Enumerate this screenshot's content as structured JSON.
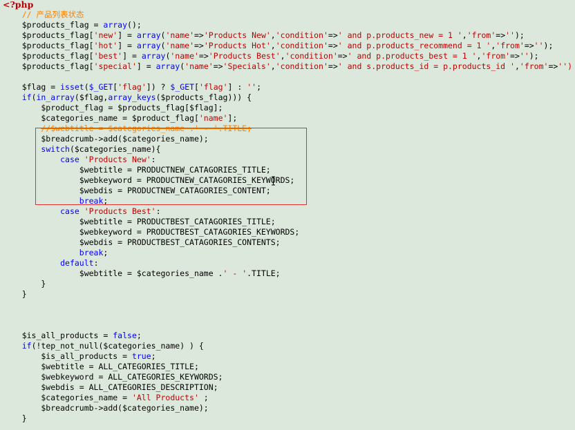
{
  "highlight_color": "#e03030",
  "background_color": "#dce8dc",
  "code_lines": [
    [
      {
        "t": "<?php",
        "c": "tag"
      }
    ],
    [
      {
        "t": "    "
      },
      {
        "t": "// 产品列表状态",
        "c": "cm"
      }
    ],
    [
      {
        "t": "    $products_flag = "
      },
      {
        "t": "array",
        "c": "kw"
      },
      {
        "t": "();"
      }
    ],
    [
      {
        "t": "    $products_flag["
      },
      {
        "t": "'new'",
        "c": "str"
      },
      {
        "t": "] = "
      },
      {
        "t": "array",
        "c": "kw"
      },
      {
        "t": "("
      },
      {
        "t": "'name'",
        "c": "str"
      },
      {
        "t": "=>"
      },
      {
        "t": "'Products New'",
        "c": "str"
      },
      {
        "t": ","
      },
      {
        "t": "'condition'",
        "c": "str"
      },
      {
        "t": "=>"
      },
      {
        "t": "' and p.products_new = 1 '",
        "c": "str"
      },
      {
        "t": ","
      },
      {
        "t": "'from'",
        "c": "str"
      },
      {
        "t": "=>"
      },
      {
        "t": "''",
        "c": "str"
      },
      {
        "t": ");"
      }
    ],
    [
      {
        "t": "    $products_flag["
      },
      {
        "t": "'hot'",
        "c": "str"
      },
      {
        "t": "] = "
      },
      {
        "t": "array",
        "c": "kw"
      },
      {
        "t": "("
      },
      {
        "t": "'name'",
        "c": "str"
      },
      {
        "t": "=>"
      },
      {
        "t": "'Products Hot'",
        "c": "str"
      },
      {
        "t": ","
      },
      {
        "t": "'condition'",
        "c": "str"
      },
      {
        "t": "=>"
      },
      {
        "t": "' and p.products_recommend = 1 '",
        "c": "str"
      },
      {
        "t": ","
      },
      {
        "t": "'from'",
        "c": "str"
      },
      {
        "t": "=>"
      },
      {
        "t": "''",
        "c": "str"
      },
      {
        "t": ");"
      }
    ],
    [
      {
        "t": "    $products_flag["
      },
      {
        "t": "'best'",
        "c": "str"
      },
      {
        "t": "] = "
      },
      {
        "t": "array",
        "c": "kw"
      },
      {
        "t": "("
      },
      {
        "t": "'name'",
        "c": "str"
      },
      {
        "t": "=>"
      },
      {
        "t": "'Products Best'",
        "c": "str"
      },
      {
        "t": ","
      },
      {
        "t": "'condition'",
        "c": "str"
      },
      {
        "t": "=>"
      },
      {
        "t": "' and p.products_best = 1 '",
        "c": "str"
      },
      {
        "t": ","
      },
      {
        "t": "'from'",
        "c": "str"
      },
      {
        "t": "=>"
      },
      {
        "t": "''",
        "c": "str"
      },
      {
        "t": ");"
      }
    ],
    [
      {
        "t": "    $products_flag["
      },
      {
        "t": "'special'",
        "c": "str"
      },
      {
        "t": "] = "
      },
      {
        "t": "array",
        "c": "kw"
      },
      {
        "t": "("
      },
      {
        "t": "'name'",
        "c": "str"
      },
      {
        "t": "=>"
      },
      {
        "t": "'Specials'",
        "c": "str"
      },
      {
        "t": ","
      },
      {
        "t": "'condition'",
        "c": "str"
      },
      {
        "t": "=>"
      },
      {
        "t": "' and s.products_id = p.products_id '",
        "c": "str"
      },
      {
        "t": ","
      },
      {
        "t": "'from'",
        "c": "str"
      },
      {
        "t": "=>"
      },
      {
        "t": "'')",
        "c": "str"
      }
    ],
    [
      {
        "t": ""
      }
    ],
    [
      {
        "t": "    $flag = "
      },
      {
        "t": "isset",
        "c": "kw"
      },
      {
        "t": "("
      },
      {
        "t": "$_GET",
        "c": "kw"
      },
      {
        "t": "["
      },
      {
        "t": "'flag'",
        "c": "str"
      },
      {
        "t": "]) ? "
      },
      {
        "t": "$_GET",
        "c": "kw"
      },
      {
        "t": "["
      },
      {
        "t": "'flag'",
        "c": "str"
      },
      {
        "t": "] : "
      },
      {
        "t": "''",
        "c": "str"
      },
      {
        "t": ";"
      }
    ],
    [
      {
        "t": "    "
      },
      {
        "t": "if",
        "c": "kw"
      },
      {
        "t": "("
      },
      {
        "t": "in_array",
        "c": "kw"
      },
      {
        "t": "($flag,"
      },
      {
        "t": "array_keys",
        "c": "kw"
      },
      {
        "t": "($products_flag))) {"
      }
    ],
    [
      {
        "t": "        $product_flag = $products_flag[$flag];"
      }
    ],
    [
      {
        "t": "        $categories_name = $product_flag["
      },
      {
        "t": "'name'",
        "c": "str"
      },
      {
        "t": "];"
      }
    ],
    [
      {
        "t": "        "
      },
      {
        "t": "//$webtitle = $categories_name .' - '.TITLE;",
        "c": "strike"
      }
    ],
    [
      {
        "t": "        $breadcrumb->add($categories_name);"
      }
    ],
    [
      {
        "t": "        "
      },
      {
        "t": "switch",
        "c": "kw"
      },
      {
        "t": "($categories_name){"
      }
    ],
    [
      {
        "t": "            "
      },
      {
        "t": "case",
        "c": "kw"
      },
      {
        "t": " "
      },
      {
        "t": "'Products New'",
        "c": "str"
      },
      {
        "t": ":"
      }
    ],
    [
      {
        "t": "                $webtitle = PRODUCTNEW_CATAGORIES_TITLE;"
      }
    ],
    [
      {
        "t": "                $webkeyword = PRODUCTNEW_CATAGORIES_KEYWORDS;"
      }
    ],
    [
      {
        "t": "                $webdis = PRODUCTNEW_CATAGORIES_CONTENT;"
      }
    ],
    [
      {
        "t": "                "
      },
      {
        "t": "break",
        "c": "kw"
      },
      {
        "t": ";"
      }
    ],
    [
      {
        "t": "            "
      },
      {
        "t": "case",
        "c": "kw"
      },
      {
        "t": " "
      },
      {
        "t": "'Products Best'",
        "c": "str"
      },
      {
        "t": ":"
      }
    ],
    [
      {
        "t": "                $webtitle = PRODUCTBEST_CATAGORIES_TITLE;"
      }
    ],
    [
      {
        "t": "                $webkeyword = PRODUCTBEST_CATAGORIES_KEYWORDS;"
      }
    ],
    [
      {
        "t": "                $webdis = PRODUCTBEST_CATAGORIES_CONTENTS;"
      }
    ],
    [
      {
        "t": "                "
      },
      {
        "t": "break",
        "c": "kw"
      },
      {
        "t": ";"
      }
    ],
    [
      {
        "t": "            "
      },
      {
        "t": "default",
        "c": "kw"
      },
      {
        "t": ":"
      }
    ],
    [
      {
        "t": "                $webtitle = $categories_name ."
      },
      {
        "t": "' - '",
        "c": "str"
      },
      {
        "t": ".TITLE;"
      }
    ],
    [
      {
        "t": "        }"
      }
    ],
    [
      {
        "t": "    }"
      }
    ],
    [
      {
        "t": ""
      }
    ],
    [
      {
        "t": ""
      }
    ],
    [
      {
        "t": ""
      }
    ],
    [
      {
        "t": "    $is_all_products = "
      },
      {
        "t": "false",
        "c": "kw"
      },
      {
        "t": ";"
      }
    ],
    [
      {
        "t": "    "
      },
      {
        "t": "if",
        "c": "kw"
      },
      {
        "t": "(!tep_not_null($categories_name) ) {"
      }
    ],
    [
      {
        "t": "        $is_all_products = "
      },
      {
        "t": "true",
        "c": "kw"
      },
      {
        "t": ";"
      }
    ],
    [
      {
        "t": "        $webtitle = ALL_CATEGORIES_TITLE;"
      }
    ],
    [
      {
        "t": "        $webkeyword = ALL_CATEGORIES_KEYWORDS;"
      }
    ],
    [
      {
        "t": "        $webdis = ALL_CATEGORIES_DESCRIPTION;"
      }
    ],
    [
      {
        "t": "        $categories_name = "
      },
      {
        "t": "'All Products'",
        "c": "str"
      },
      {
        "t": " ;"
      }
    ],
    [
      {
        "t": "        $breadcrumb->add($categories_name);"
      }
    ],
    [
      {
        "t": "    }"
      }
    ]
  ]
}
